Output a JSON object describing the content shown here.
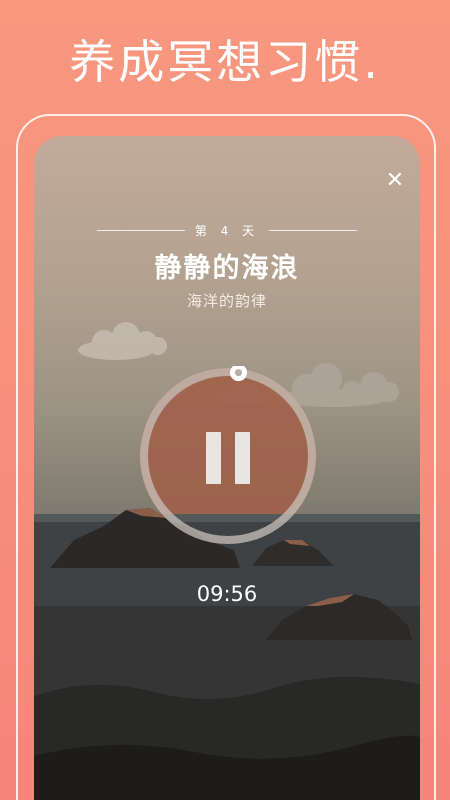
{
  "header": {
    "headline": "养成冥想习惯."
  },
  "session": {
    "day_label": "第 4 天",
    "title": "静静的海浪",
    "subtitle": "海洋的韵律",
    "timer": "09:56",
    "progress": 0.02
  },
  "icons": {
    "close": "close-icon",
    "pause": "pause-icon"
  },
  "colors": {
    "background": "#f88f7c",
    "text": "#ffffff",
    "sun": "#a0614a",
    "ring": "#c9c1bb"
  }
}
